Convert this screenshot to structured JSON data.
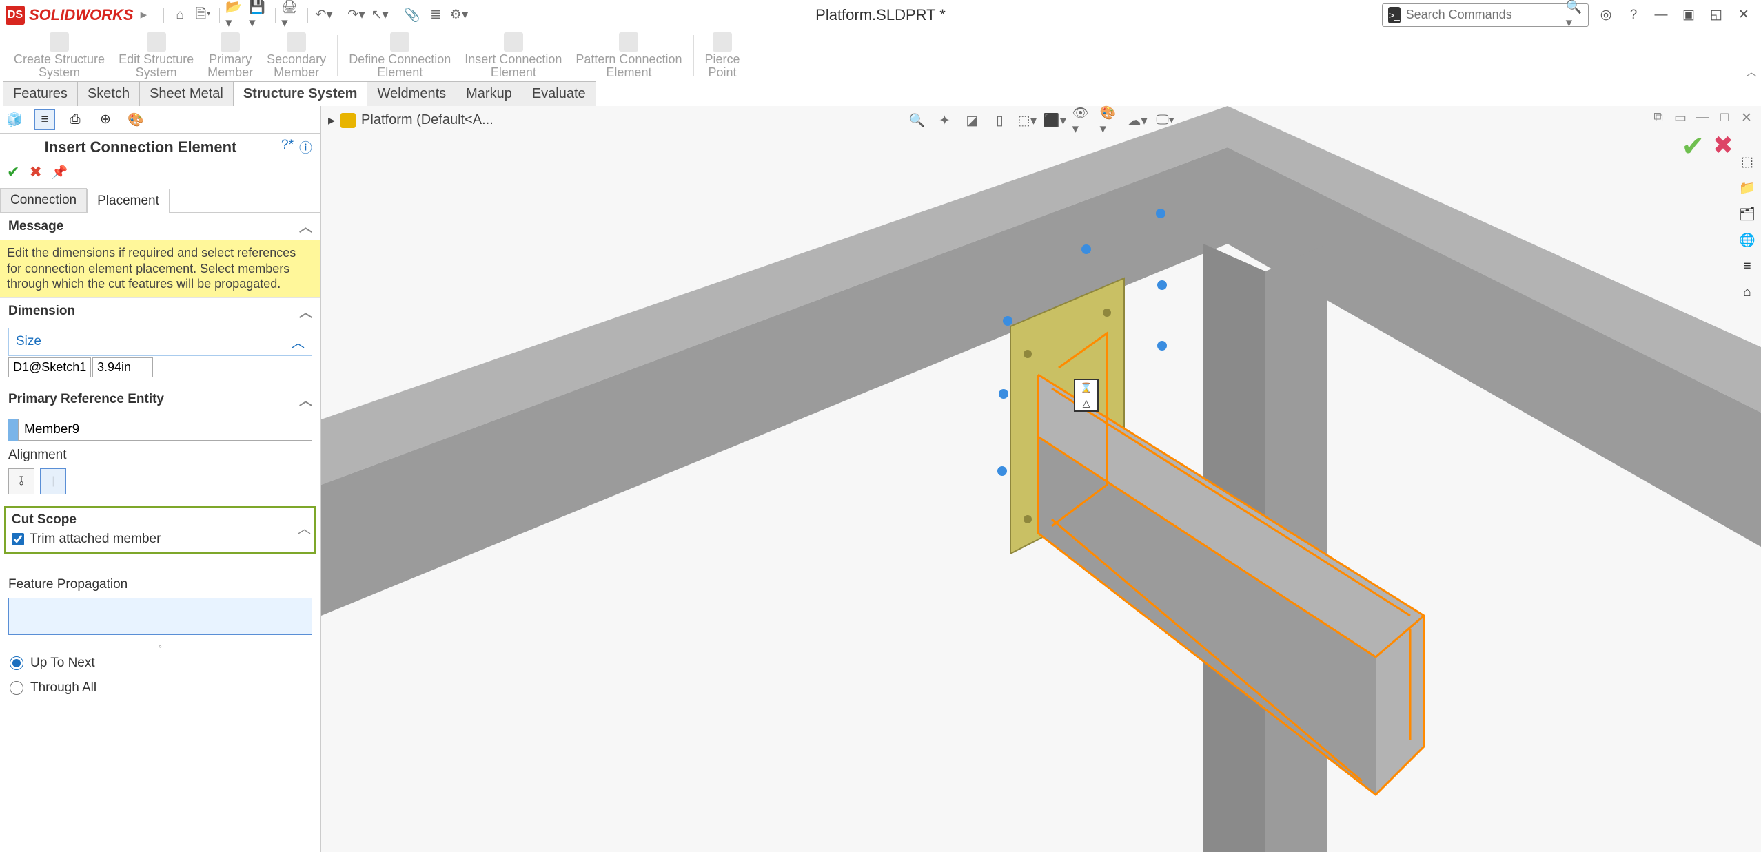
{
  "app": {
    "name": "SOLIDWORKS",
    "doc_title": "Platform.SLDPRT *"
  },
  "search": {
    "placeholder": "Search Commands"
  },
  "ribbon": [
    {
      "label1": "Create Structure",
      "label2": "System"
    },
    {
      "label1": "Edit Structure",
      "label2": "System"
    },
    {
      "label1": "Primary",
      "label2": "Member"
    },
    {
      "label1": "Secondary",
      "label2": "Member"
    },
    {
      "label1": "Define Connection",
      "label2": "Element"
    },
    {
      "label1": "Insert Connection",
      "label2": "Element"
    },
    {
      "label1": "Pattern Connection",
      "label2": "Element"
    },
    {
      "label1": "Pierce",
      "label2": "Point"
    }
  ],
  "tabs": [
    "Features",
    "Sketch",
    "Sheet Metal",
    "Structure System",
    "Weldments",
    "Markup",
    "Evaluate"
  ],
  "active_tab": "Structure System",
  "pm": {
    "title": "Insert Connection Element",
    "inner_tabs": [
      "Connection",
      "Placement"
    ],
    "active_inner": "Placement",
    "message_header": "Message",
    "message_body": "Edit the dimensions if required and select references for connection element placement. Select members through which the cut features will be propagated.",
    "dimension_header": "Dimension",
    "size_label": "Size",
    "dim_name": "D1@Sketch1",
    "dim_value": "3.94in",
    "pre_header": "Primary Reference Entity",
    "pre_value": "Member9",
    "alignment_label": "Alignment",
    "cutscope_header": "Cut Scope",
    "trim_label": "Trim attached member",
    "trim_checked": true,
    "fp_label": "Feature Propagation",
    "radios": {
      "upnext": "Up To Next",
      "throughall": "Through All",
      "selected": "upnext"
    }
  },
  "breadcrumb": "Platform (Default<A..."
}
